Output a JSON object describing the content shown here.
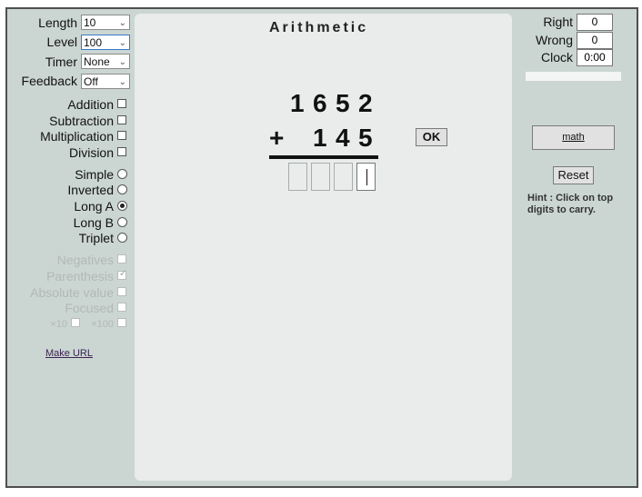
{
  "settings": {
    "length_label": "Length",
    "length_value": "10",
    "level_label": "Level",
    "level_value": "100",
    "timer_label": "Timer",
    "timer_value": "None",
    "feedback_label": "Feedback",
    "feedback_value": "Off"
  },
  "operations": {
    "addition": "Addition",
    "subtraction": "Subtraction",
    "multiplication": "Multiplication",
    "division": "Division"
  },
  "modes": {
    "simple": "Simple",
    "inverted": "Inverted",
    "long_a": "Long A",
    "long_b": "Long B",
    "triplet": "Triplet",
    "selected": "Long A"
  },
  "options": {
    "negatives": "Negatives",
    "parenthesis": "Parenthesis",
    "absolute_value": "Absolute value",
    "focused": "Focused",
    "x10": "×10",
    "x100": "×100"
  },
  "make_url": "Make URL",
  "title": "Arithmetic",
  "problem": {
    "top_digits": [
      "1",
      "6",
      "5",
      "2"
    ],
    "operator": "+",
    "bottom_digits": [
      "1",
      "4",
      "5"
    ],
    "ok_label": "OK"
  },
  "score": {
    "right_label": "Right",
    "right_value": "0",
    "wrong_label": "Wrong",
    "wrong_value": "0",
    "clock_label": "Clock",
    "clock_value": "0:00"
  },
  "math_button": "math",
  "reset_button": "Reset",
  "hint": "Hint : Click on top digits to carry."
}
